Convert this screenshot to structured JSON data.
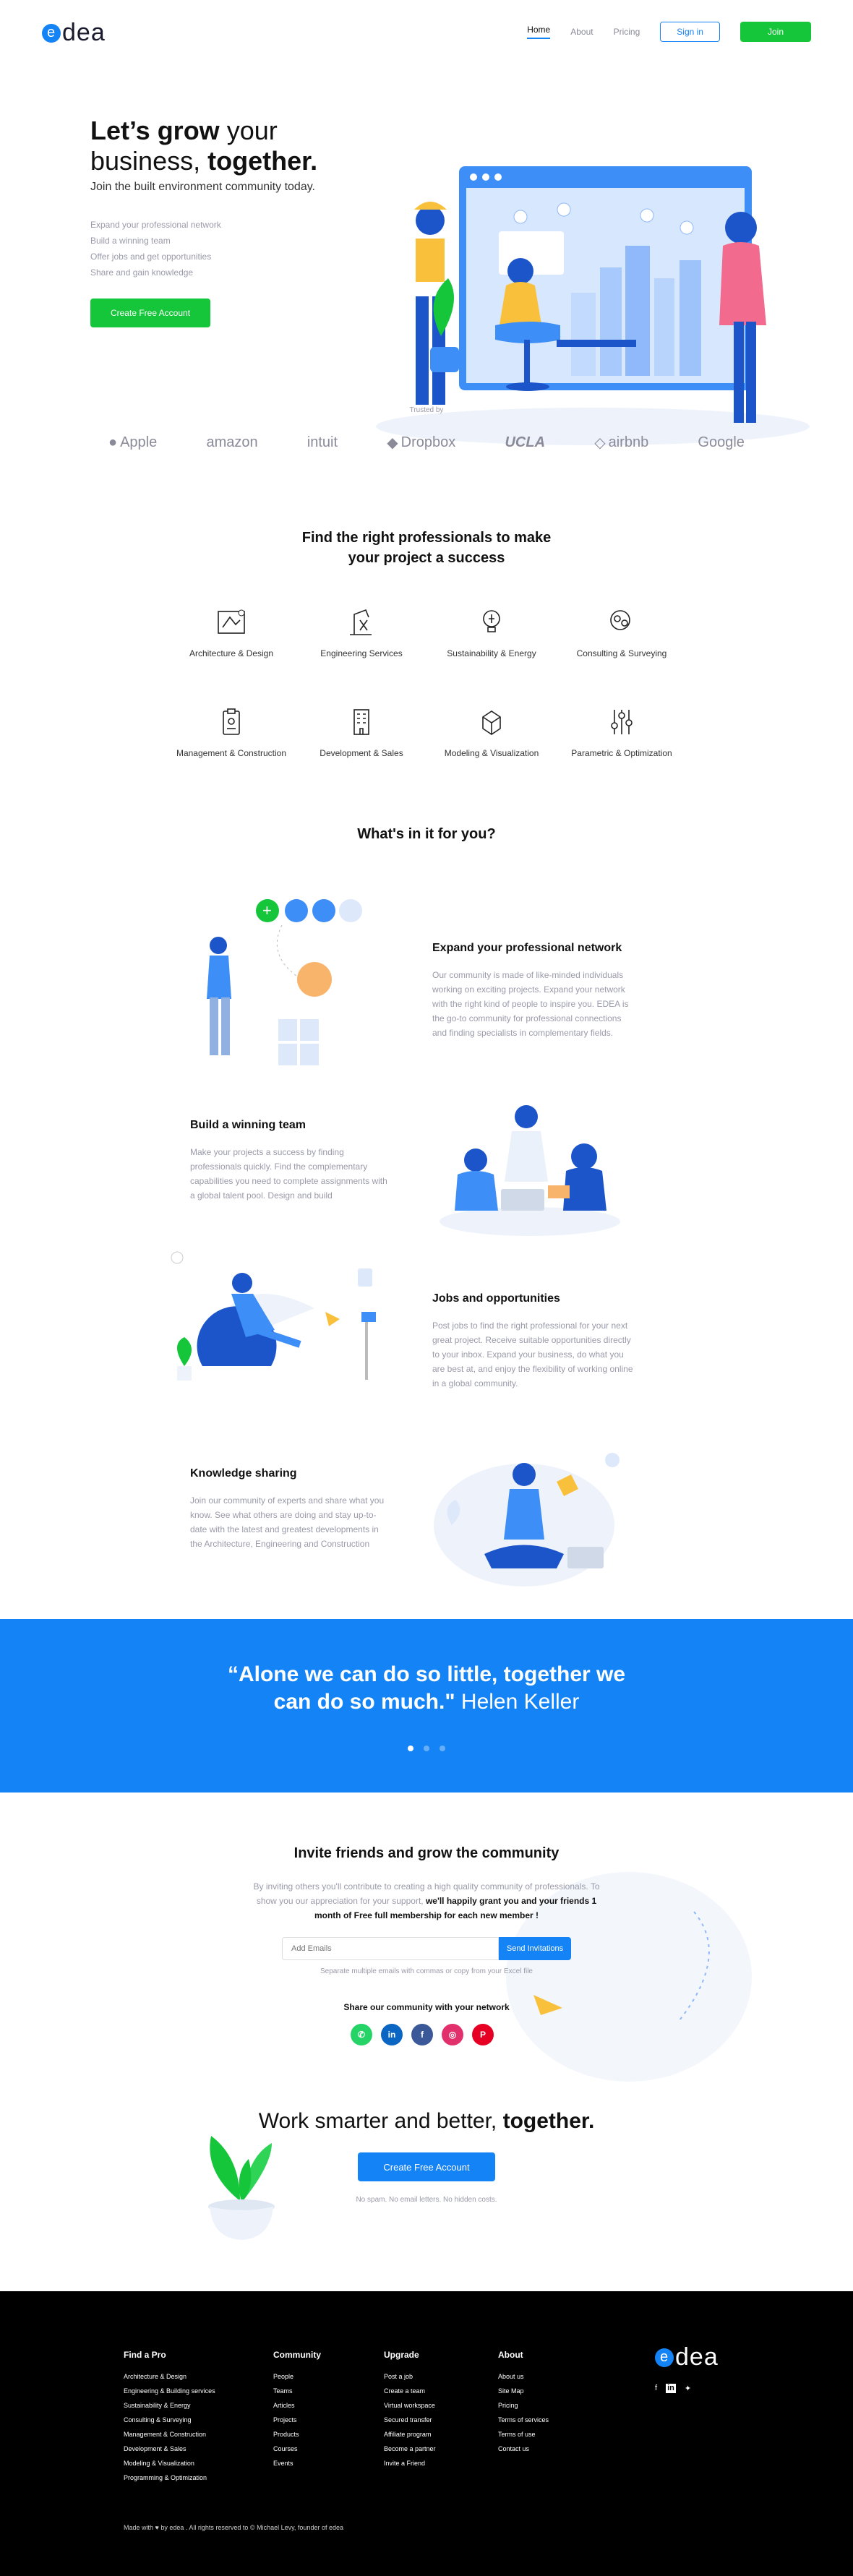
{
  "header": {
    "logo": "edea",
    "nav": [
      {
        "label": "Home",
        "active": true
      },
      {
        "label": "About",
        "active": false
      },
      {
        "label": "Pricing",
        "active": false
      }
    ],
    "signin_label": "Sign in",
    "join_label": "Join"
  },
  "hero": {
    "title_a": "Let’s grow",
    "title_b": " your",
    "title_c": "business, ",
    "title_d": "together.",
    "subtitle": "Join the built environment community today.",
    "bullets": [
      "Expand your professional network",
      "Build a winning team",
      "Offer jobs and get opportunities",
      "Share and gain knowledge"
    ],
    "cta": "Create Free Account"
  },
  "trusted": {
    "label": "Trusted by",
    "logos": [
      "Apple",
      "amazon",
      "intuit",
      "Dropbox",
      "UCLA",
      "airbnb",
      "Google"
    ]
  },
  "professionals": {
    "title_line1": "Find the right professionals to make",
    "title_line2": "your project a success",
    "items": [
      {
        "label": "Architecture & Design",
        "icon": "blueprint-icon"
      },
      {
        "label": "Engineering Services",
        "icon": "crane-icon"
      },
      {
        "label": "Sustainability & Energy",
        "icon": "bulb-icon"
      },
      {
        "label": "Consulting & Surveying",
        "icon": "consulting-icon"
      },
      {
        "label": "Management & Construction",
        "icon": "clipboard-icon"
      },
      {
        "label": "Development & Sales",
        "icon": "building-icon"
      },
      {
        "label": "Modeling & Visualization",
        "icon": "cube-icon"
      },
      {
        "label": "Parametric & Optimization",
        "icon": "sliders-icon"
      }
    ]
  },
  "benefits": {
    "title": "What's in it for you?",
    "items": [
      {
        "title": "Expand your professional network",
        "text": "Our community is made of like-minded individuals working on exciting projects. Expand your network with the right kind of people to inspire you. EDEA is the go-to community for professional connections and finding specialists in complementary fields."
      },
      {
        "title": "Build a winning team",
        "text": "Make your projects a success by finding professionals quickly. Find the complementary capabilities you need to complete assignments with a global talent pool. Design and build"
      },
      {
        "title": "Jobs and opportunities",
        "text": "Post jobs to find the right professional for your next great project. Receive suitable opportunities directly to your inbox. Expand your business, do what you are best at, and enjoy the flexibility of working online in a global community."
      },
      {
        "title": "Knowledge sharing",
        "text": "Join our community of experts and share what you know. See what others are doing and stay up-to-date with the latest and greatest developments in the Architecture, Engineering and Construction"
      }
    ]
  },
  "quote": {
    "text": "“Alone we can do so little, together we can do so much.”",
    "line1": "“Alone we can do so little, together we",
    "line2": "can do so much.\"",
    "author": " Helen Keller",
    "slides": 3,
    "active_slide": 1
  },
  "invite": {
    "title": "Invite friends and grow the community",
    "text_a": "By inviting others you'll contribute to creating a high quality community of professionals. To show you our appreciation for your support, ",
    "text_b": "we'll happily grant you and your friends 1 month of Free full membership for each new member !",
    "placeholder": "Add Emails",
    "button": "Send Invitations",
    "hint": "Separate multiple emails with commas or copy from your Excel file",
    "share_title": "Share our community with your network",
    "socials": [
      {
        "name": "whatsapp-icon",
        "glyph": "✆",
        "color": "#25d366"
      },
      {
        "name": "linkedin-icon",
        "glyph": "in",
        "color": "#0a66c2"
      },
      {
        "name": "facebook-icon",
        "glyph": "f",
        "color": "#3b5998"
      },
      {
        "name": "instagram-icon",
        "glyph": "◎",
        "color": "#e1306c"
      },
      {
        "name": "pinterest-icon",
        "glyph": "P",
        "color": "#e60023"
      }
    ]
  },
  "smarter": {
    "title_a": "Work smarter and better, ",
    "title_b": "together.",
    "cta": "Create Free Account",
    "note": "No spam. No email letters. No hidden costs."
  },
  "footer": {
    "columns": [
      {
        "title": "Find a Pro",
        "items": [
          "Architecture & Design",
          "Engineering & Building services",
          "Sustainability & Energy",
          "Consulting & Surveying",
          "Management & Construction",
          "Development & Sales",
          "Modeling & Visualization",
          "Programming & Optimization"
        ]
      },
      {
        "title": "Community",
        "items": [
          "People",
          "Teams",
          "Articles",
          "Projects",
          "Products",
          "Courses",
          "Events"
        ]
      },
      {
        "title": "Upgrade",
        "items": [
          "Post a job",
          "Create a team",
          "Virtual workspace",
          "Secured transfer",
          "Affiliate program",
          "Become a partner",
          "Invite a Friend"
        ]
      },
      {
        "title": "About",
        "items": [
          "About us",
          "Site Map",
          "Pricing",
          "Terms of services",
          "Terms of use",
          "Contact us"
        ]
      }
    ],
    "logo": "edea",
    "copyright_a": "Made with ",
    "copyright_b": " by edea . All rights reserved to © Michael Levy, founder of edea"
  },
  "colors": {
    "primary": "#1483f5",
    "green": "#15c63a",
    "footer": "#000000"
  }
}
